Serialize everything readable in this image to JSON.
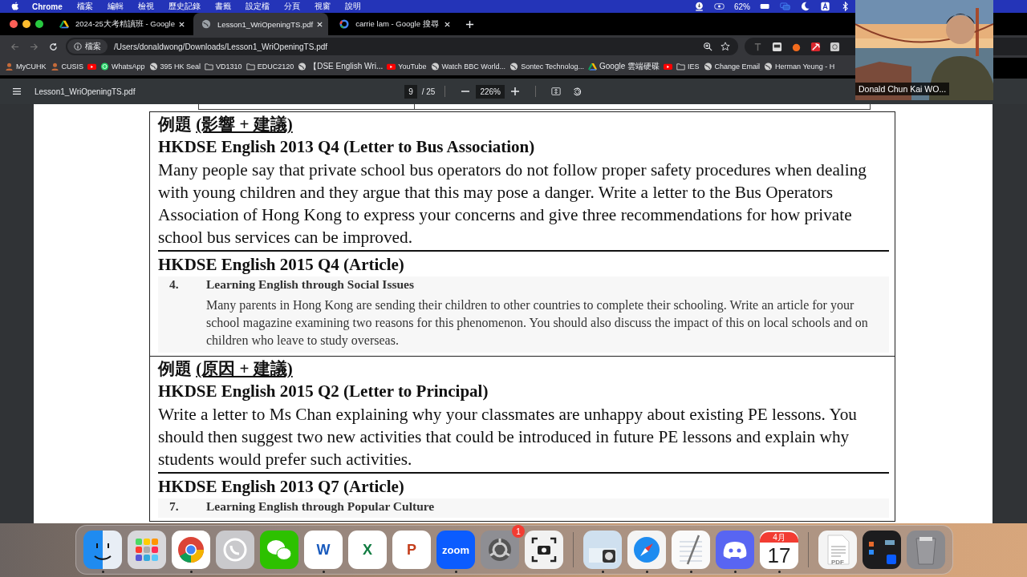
{
  "menu_bar": {
    "app": "Chrome",
    "items": [
      "檔案",
      "編輯",
      "檢視",
      "歷史記錄",
      "書籤",
      "設定檔",
      "分頁",
      "視窗",
      "說明"
    ],
    "battery": "62%"
  },
  "tabs": [
    {
      "title": "2024-25大考精讀班 - Google",
      "kind": "drive",
      "selected": false
    },
    {
      "title": "Lesson1_WriOpeningTS.pdf",
      "kind": "globe",
      "selected": true
    },
    {
      "title": "carrie lam - Google 搜尋",
      "kind": "google",
      "selected": false
    }
  ],
  "address_bar": {
    "scheme": "檔案",
    "url": "/Users/donaldwong/Downloads/Lesson1_WriOpeningTS.pdf"
  },
  "bookmarks": [
    {
      "label": "MyCUHK",
      "kind": "person"
    },
    {
      "label": "CUSIS",
      "kind": "person"
    },
    {
      "kind": "youtube"
    },
    {
      "label": "WhatsApp",
      "kind": "whatsapp"
    },
    {
      "label": "395 HK Seal",
      "kind": "globe"
    },
    {
      "label": "VD1310",
      "kind": "folder"
    },
    {
      "label": "EDUC2120",
      "kind": "folder"
    },
    {
      "label": "【DSE English Wri...",
      "kind": "globe"
    },
    {
      "label": "YouTube",
      "kind": "youtube"
    },
    {
      "label": "Watch BBC World...",
      "kind": "globe"
    },
    {
      "label": "Sontec Technolog...",
      "kind": "globe"
    },
    {
      "label": "Google 雲端硬碟",
      "kind": "drive"
    },
    {
      "kind": "youtube"
    },
    {
      "label": "IES",
      "kind": "folder"
    },
    {
      "label": "Change Email",
      "kind": "globe"
    },
    {
      "label": "Herman Yeung - H",
      "kind": "globe"
    }
  ],
  "pdf_toolbar": {
    "title": "Lesson1_WriOpeningTS.pdf",
    "page": "9",
    "total": "/ 25",
    "zoom": "226%"
  },
  "document": {
    "sections": [
      {
        "label": "例題",
        "topic": "(影響 + 建議)",
        "questions": [
          {
            "kind": "text",
            "title": "HKDSE English 2013 Q4 (Letter to Bus Association)",
            "text": "Many people say that private school bus operators do not follow proper safety procedures when dealing with young children and they argue that this may pose a danger. Write a letter to the Bus Operators Association of Hong Kong to express your concerns and give three recommendations for how private school bus services can be improved."
          },
          {
            "kind": "scan",
            "title": "HKDSE English 2015 Q4 (Article)",
            "number": "4.",
            "scan_title": "Learning English through Social Issues",
            "text": "Many parents in Hong Kong are sending their children to other countries to complete their schooling. Write an article for your school magazine examining two reasons for this phenomenon. You should also discuss the impact of this on local schools and on children who leave to study overseas."
          }
        ]
      },
      {
        "label": "例題",
        "topic": "(原因 + 建議)",
        "questions": [
          {
            "kind": "text",
            "title": "HKDSE English 2015 Q2 (Letter to Principal)",
            "text": "Write a letter to Ms Chan explaining why your classmates are unhappy about existing PE lessons. You should then suggest two new activities that could be introduced in future PE lessons and explain why students would prefer such activities."
          },
          {
            "kind": "scan",
            "title": "HKDSE English 2013 Q7 (Article)",
            "number": "7.",
            "scan_title": "Learning English through Popular Culture"
          }
        ]
      }
    ]
  },
  "video": {
    "name": "Donald Chun Kai WO..."
  },
  "dock": [
    {
      "kind": "finder",
      "running": true
    },
    {
      "kind": "launchpad",
      "running": false
    },
    {
      "kind": "chrome",
      "running": true
    },
    {
      "kind": "whatsapp",
      "running": false
    },
    {
      "kind": "wechat",
      "running": false
    },
    {
      "kind": "word",
      "glyph": "W",
      "running": true
    },
    {
      "kind": "excel",
      "glyph": "X",
      "running": false
    },
    {
      "kind": "powerpoint",
      "glyph": "P",
      "running": false
    },
    {
      "kind": "zoom",
      "glyph": "zoom",
      "running": true
    },
    {
      "kind": "settings",
      "badge": "1",
      "running": false
    },
    {
      "kind": "screenshot",
      "running": false
    },
    {
      "kind": "separator"
    },
    {
      "kind": "preview",
      "running": true
    },
    {
      "kind": "safari",
      "running": true
    },
    {
      "kind": "textedit",
      "running": true
    },
    {
      "kind": "discord",
      "running": true
    },
    {
      "kind": "calendar",
      "month": "4月",
      "day": "17",
      "running": true
    },
    {
      "kind": "separator"
    },
    {
      "kind": "pdf",
      "glyph": "PDF"
    },
    {
      "kind": "window"
    },
    {
      "kind": "trash"
    }
  ]
}
